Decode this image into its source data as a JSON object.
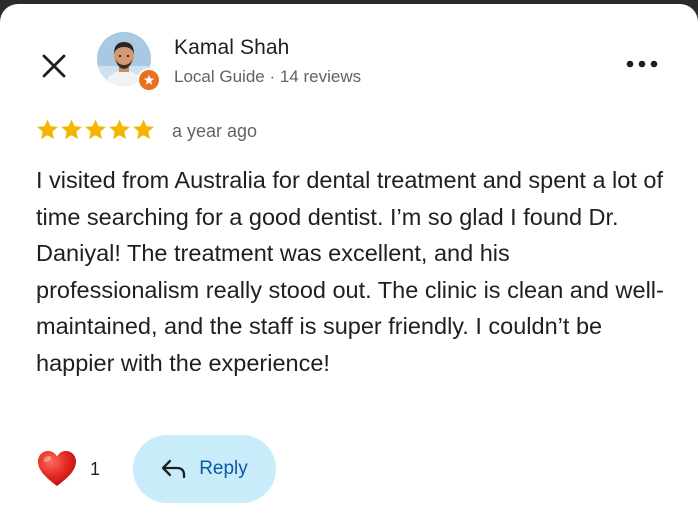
{
  "header": {
    "close_icon": "close-icon",
    "reviewer_name": "Kamal Shah",
    "reviewer_meta": "Local Guide · 14 reviews",
    "more_icon": "more-horizontal-icon"
  },
  "review": {
    "rating": 5,
    "max_rating": 5,
    "time": "a year ago",
    "text": "I visited from Australia for dental treatment and spent a lot of time searching for a good dentist. I’m so glad I found Dr. Daniyal! The treatment was excellent, and his professionalism really stood out. The clinic is clean and well-maintained, and the staff is super friendly. I couldn’t be happier with the experience!"
  },
  "actions": {
    "like_icon": "heart-icon",
    "like_count": "1",
    "reply_icon": "reply-arrow-icon",
    "reply_label": "Reply"
  },
  "colors": {
    "star": "#f4b400",
    "heart": "#d9241f",
    "reply_bg": "#c8ecfa",
    "reply_text": "#0b57a8",
    "guide_badge": "#e8711f"
  }
}
